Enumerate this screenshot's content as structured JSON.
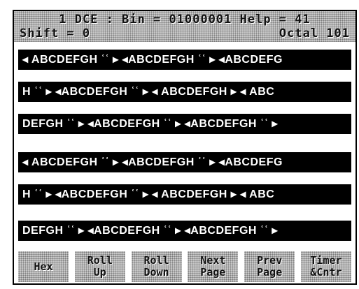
{
  "status": {
    "line1": "1 DCE : Bin = 01000001 Help = 41",
    "shift": "Shift = 0",
    "octal": "Octal 101"
  },
  "rows": [
    "◂ ABCDEFGH ʿʿ ▸ ◂ABCDEFGH ʿʿ ▸ ◂ABCDEFG",
    "H ʿʿ ▸ ◂ABCDEFGH ʿʿ ▸ ◂ ABCDEFGH ▸ ◂ ABC",
    "DEFGH ʿʿ ▸ ◂ABCDEFGH ʿʿ ▸ ◂ABCDEFGH ʿʿ ▸",
    "◂ ABCDEFGH ʿʿ ▸ ◂ABCDEFGH ʿʿ ▸ ◂ABCDEFG",
    "H ʿʿ ▸ ◂ABCDEFGH ʿʿ ▸ ◂ ABCDEFGH ▸ ◂ ABC",
    "DEFGH ʿʿ ▸ ◂ABCDEFGH ʿʿ ▸ ◂ABCDEFGH ʿʿ ▸"
  ],
  "softkeys": [
    {
      "line1": "",
      "line2": "Hex"
    },
    {
      "line1": "Roll",
      "line2": "Up"
    },
    {
      "line1": "Roll",
      "line2": "Down"
    },
    {
      "line1": "Next",
      "line2": "Page"
    },
    {
      "line1": "Prev",
      "line2": "Page"
    },
    {
      "line1": "Timer",
      "line2": "&Cntr"
    }
  ]
}
